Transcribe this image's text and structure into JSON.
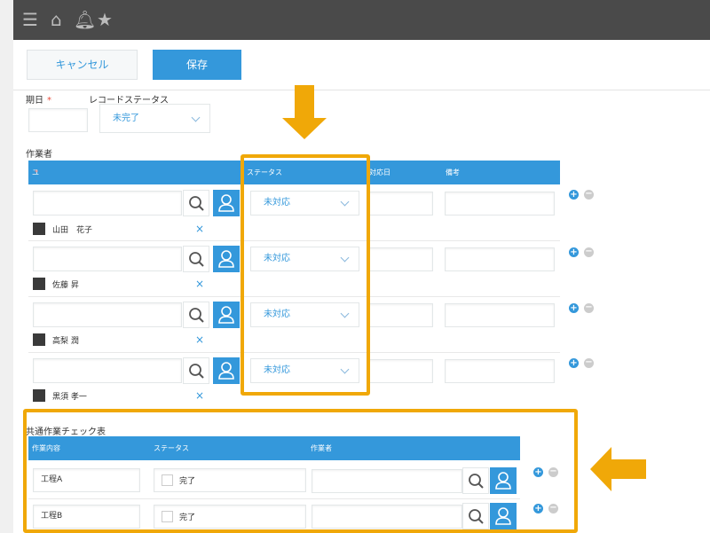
{
  "toolbar": {
    "cancel_label": "キャンセル",
    "save_label": "保存"
  },
  "fields": {
    "due_label": "期日",
    "required_mark": "*",
    "record_status_label": "レコードステータス",
    "record_status_value": "未完了"
  },
  "workers": {
    "section_label": "作業者",
    "headers": {
      "user": "ユーザー選択",
      "status": "ステータス",
      "date": "対応日",
      "notes": "備考"
    },
    "rows": [
      {
        "user": "山田　花子",
        "status": "未対応"
      },
      {
        "user": "佐藤 昇",
        "status": "未対応"
      },
      {
        "user": "高梨 潤",
        "status": "未対応"
      },
      {
        "user": "黒須 孝一",
        "status": "未対応"
      }
    ]
  },
  "checklist": {
    "section_label": "共通作業チェック表",
    "headers": {
      "task": "作業内容",
      "status": "ステータス",
      "worker": "作業者"
    },
    "rows": [
      {
        "task": "工程A",
        "status": "完了"
      },
      {
        "task": "工程B",
        "status": "完了"
      }
    ]
  },
  "icons": [
    "menu-icon",
    "home-icon",
    "bell-icon",
    "star-icon",
    "search-icon",
    "user-icon",
    "close-icon",
    "plus-icon",
    "minus-icon",
    "chevron-down-icon"
  ],
  "colors": {
    "accent": "#3498db",
    "highlight": "#f0a808",
    "topbar": "#4a4a4a"
  }
}
